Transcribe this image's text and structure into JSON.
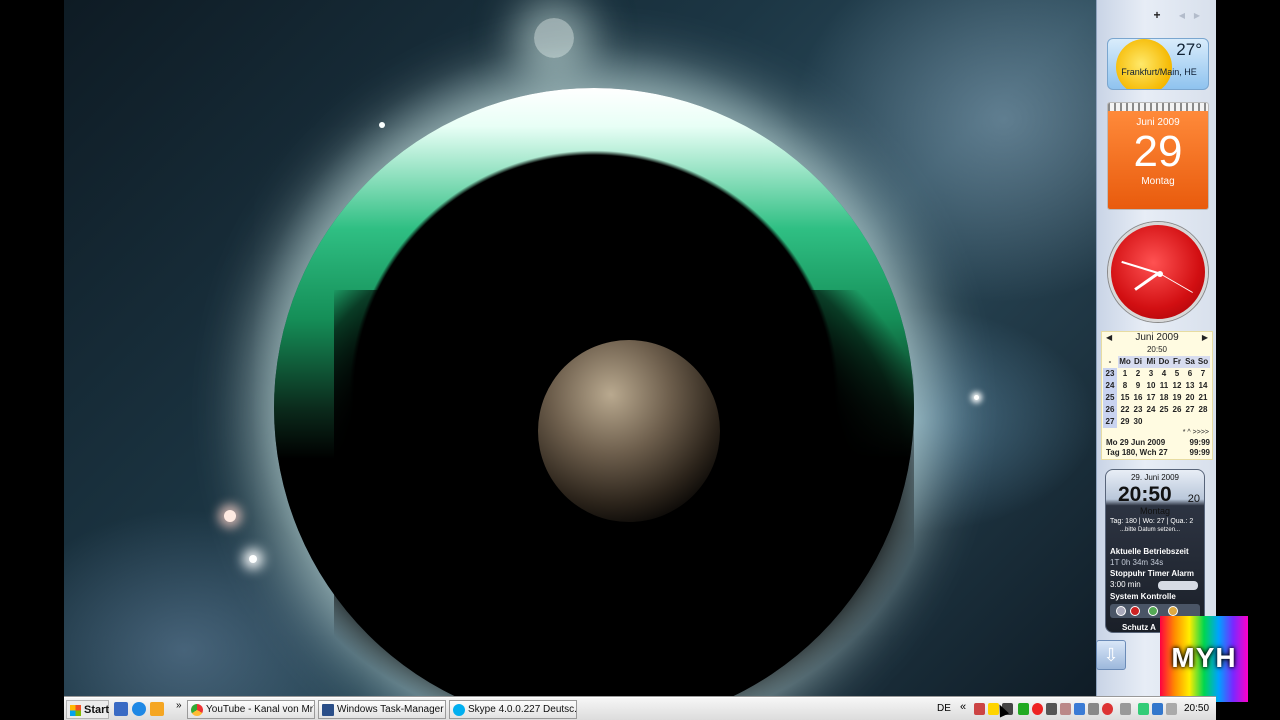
{
  "sidebar": {
    "add_label": "+",
    "prev_label": "◀",
    "next_label": "▶",
    "weather": {
      "temperature": "27°",
      "city": "Frankfurt/Main, HE"
    },
    "calendar": {
      "month": "Juni 2009",
      "day": "29",
      "weekday": "Montag"
    },
    "month_calendar": {
      "title": "Juni 2009",
      "time": "20:50",
      "prev": "◀",
      "next": "▶",
      "corner": "-",
      "headers": [
        "Mo",
        "Di",
        "Mi",
        "Do",
        "Fr",
        "Sa",
        "So"
      ],
      "weeks": [
        {
          "wk": "23",
          "days": [
            "1",
            "2",
            "3",
            "4",
            "5",
            "6",
            "7"
          ]
        },
        {
          "wk": "24",
          "days": [
            "8",
            "9",
            "10",
            "11",
            "12",
            "13",
            "14"
          ]
        },
        {
          "wk": "25",
          "days": [
            "15",
            "16",
            "17",
            "18",
            "19",
            "20",
            "21"
          ]
        },
        {
          "wk": "26",
          "days": [
            "22",
            "23",
            "24",
            "25",
            "26",
            "27",
            "28"
          ]
        },
        {
          "wk": "27",
          "days": [
            "29",
            "30",
            "",
            "",
            "",
            "",
            ""
          ]
        }
      ],
      "nav": "* ^ >>>>",
      "footer1_left": "Mo 29 Jun 2009",
      "footer1_right": "99:99",
      "footer2_left": "Tag 180, Wch 27",
      "footer2_right": "99:99"
    },
    "system_widget": {
      "date": "29. Juni 2009",
      "time": "20:50",
      "seconds": "20",
      "weekday": "Montag",
      "day_info": "Tag: 180 | Wo: 27 | Qua.: 2",
      "date_hint": "...bitte Datum setzen...",
      "uptime_label": "Aktuelle Betriebszeit",
      "uptime_value": "1T 0h 34m 34s",
      "stopwatch_label": "Stoppuhr Timer Alarm",
      "timer_value": "3:00 min",
      "system_label": "System Kontrolle",
      "shield_label": "Schutz A"
    }
  },
  "logo": {
    "text": "MYH"
  },
  "taskbar": {
    "start_label": "Start",
    "quicklaunch_more": "»",
    "tasks": [
      {
        "label": "YouTube - Kanal von MrY..."
      },
      {
        "label": "Windows Task-Manager"
      },
      {
        "label": "Skype 4.0.0.227 Deutsc..."
      }
    ],
    "language": "DE",
    "tray_chevron": "«",
    "clock": "20:50"
  },
  "colors": {
    "calendar_orange": "#f06a1a",
    "clock_red": "#d20f12"
  }
}
